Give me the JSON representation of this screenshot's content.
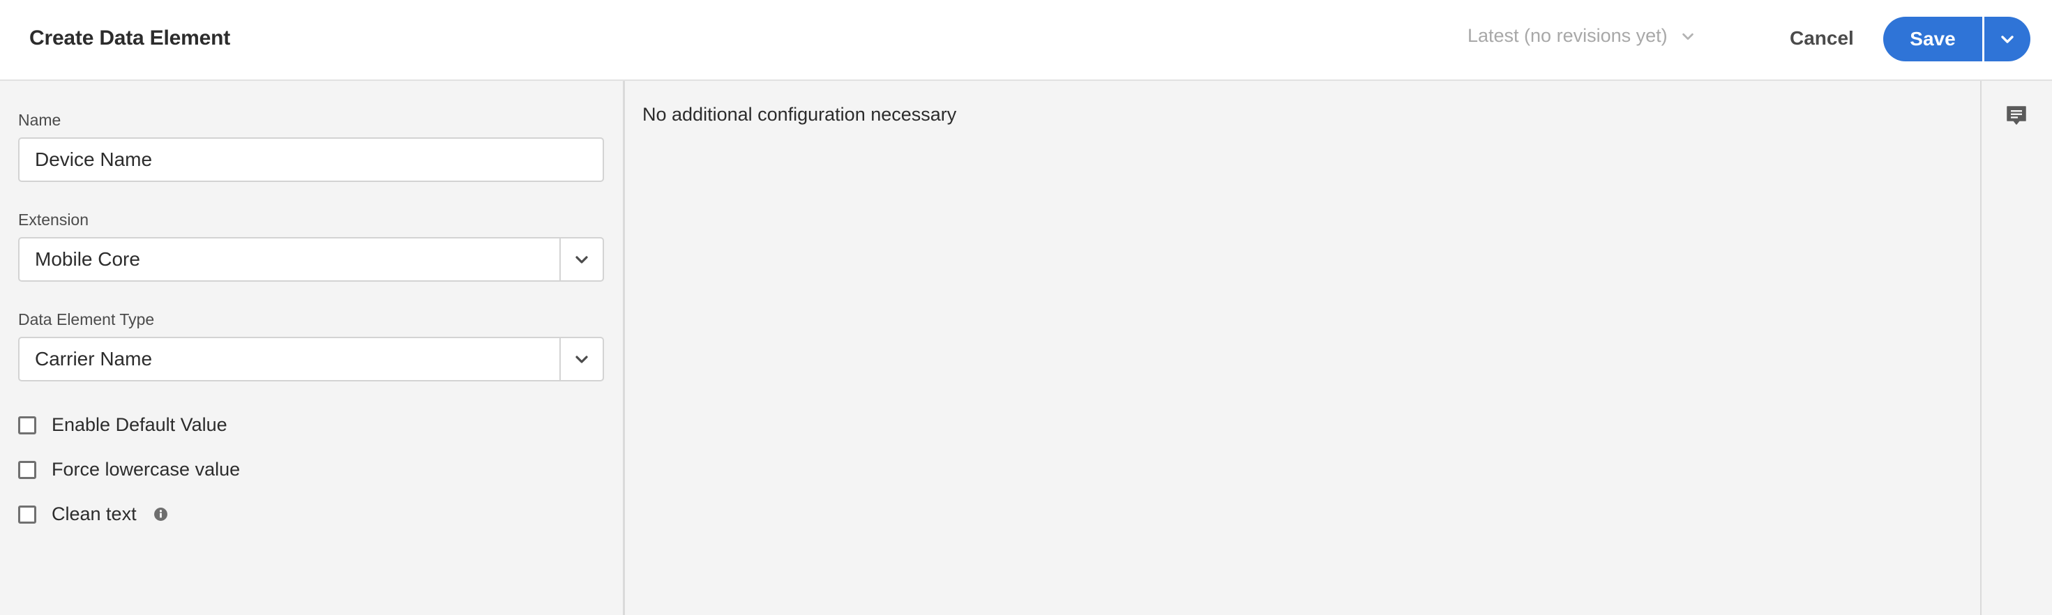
{
  "header": {
    "title": "Create Data Element",
    "revision_label": "Latest (no revisions yet)",
    "cancel_label": "Cancel",
    "save_label": "Save"
  },
  "form": {
    "name": {
      "label": "Name",
      "value": "Device Name"
    },
    "extension": {
      "label": "Extension",
      "value": "Mobile Core"
    },
    "data_element_type": {
      "label": "Data Element Type",
      "value": "Carrier Name"
    },
    "checkboxes": [
      {
        "label": "Enable Default Value",
        "checked": false
      },
      {
        "label": "Force lowercase value",
        "checked": false
      },
      {
        "label": "Clean text",
        "checked": false,
        "has_info_icon": true
      }
    ]
  },
  "main": {
    "message": "No additional configuration necessary"
  },
  "icons": {
    "revision_chevron": "chevron-down-icon",
    "save_menu": "chevron-down-icon",
    "select_toggle": "chevron-down-icon",
    "info": "info-icon",
    "comments": "comment-icon"
  },
  "colors": {
    "accent": "#2f74d7",
    "background": "#f4f4f4",
    "header_background": "#ffffff",
    "muted_text": "#a8a8a8"
  }
}
